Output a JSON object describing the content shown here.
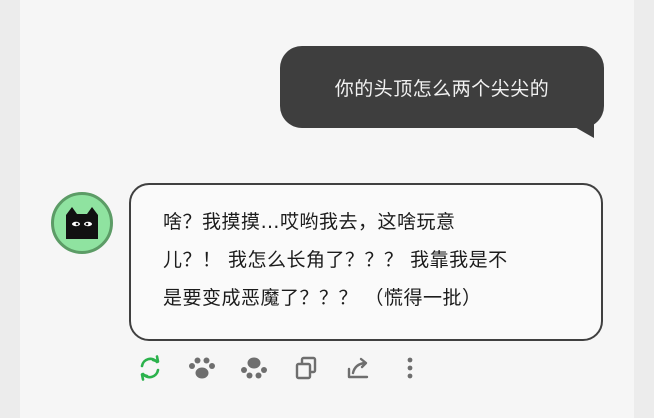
{
  "chat": {
    "user_message": "你的头顶怎么两个尖尖的",
    "ai_reply_lines": [
      "啥？我摸摸…哎哟我去，这啥玩意",
      "儿？！ 我怎么长角了？？？ 我靠我是不",
      "是要变成恶魔了？？？ （慌得一批）"
    ]
  },
  "actions": [
    {
      "icon": "refresh-icon"
    },
    {
      "icon": "paw-icon"
    },
    {
      "icon": "paw-icon"
    },
    {
      "icon": "copy-icon"
    },
    {
      "icon": "share-icon"
    },
    {
      "icon": "more-vertical-icon"
    }
  ],
  "colors": {
    "user_bubble": "#3e3e3e",
    "avatar_bg": "#8fe3a0",
    "accent_green": "#2bb24c",
    "icon_gray": "#6e6e6e"
  }
}
